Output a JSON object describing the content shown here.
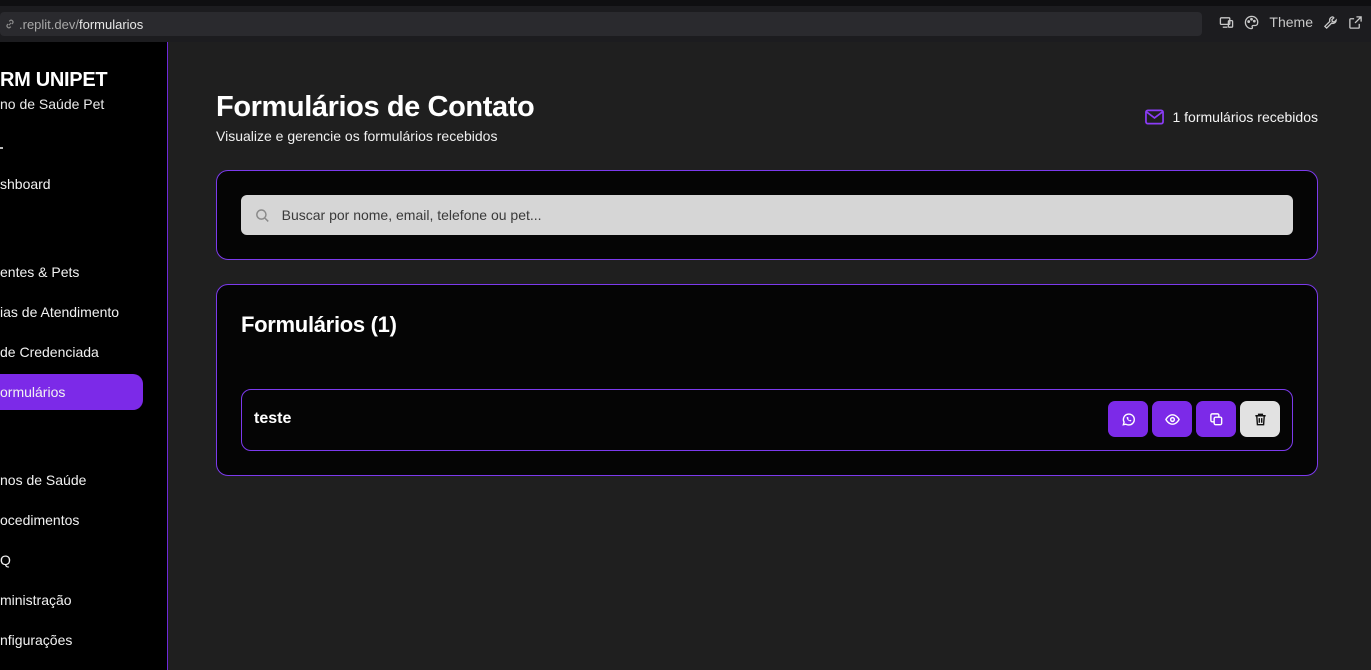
{
  "browser": {
    "url_host": ".replit.dev/",
    "url_path": "formularios",
    "theme_label": "Theme"
  },
  "sidebar": {
    "brand": "RM UNIPET",
    "brand_sub": "no de Saúde Pet",
    "items": [
      {
        "label": "shboard",
        "active": false
      },
      {
        "label": "entes & Pets",
        "active": false
      },
      {
        "label": "ias de Atendimento",
        "active": false
      },
      {
        "label": "de Credenciada",
        "active": false
      },
      {
        "label": "ormulários",
        "active": true
      },
      {
        "label": "nos de Saúde",
        "active": false
      },
      {
        "label": "ocedimentos",
        "active": false
      },
      {
        "label": "Q",
        "active": false
      },
      {
        "label": "ministração",
        "active": false
      },
      {
        "label": "nfigurações",
        "active": false
      }
    ]
  },
  "header": {
    "title": "Formulários de Contato",
    "subtitle": "Visualize e gerencie os formulários recebidos",
    "count_label": "1 formulários recebidos"
  },
  "search": {
    "placeholder": "Buscar por nome, email, telefone ou pet...",
    "value": ""
  },
  "list": {
    "title": "Formulários (1)",
    "rows": [
      {
        "name": "teste"
      }
    ]
  },
  "colors": {
    "accent": "#7c2ae8",
    "border": "#7c3aed",
    "background": "#1f1f1f"
  },
  "icons": {
    "mail": "mail-icon",
    "search": "search-icon",
    "whatsapp": "whatsapp-icon",
    "view": "eye-icon",
    "copy": "copy-icon",
    "delete": "trash-icon"
  }
}
